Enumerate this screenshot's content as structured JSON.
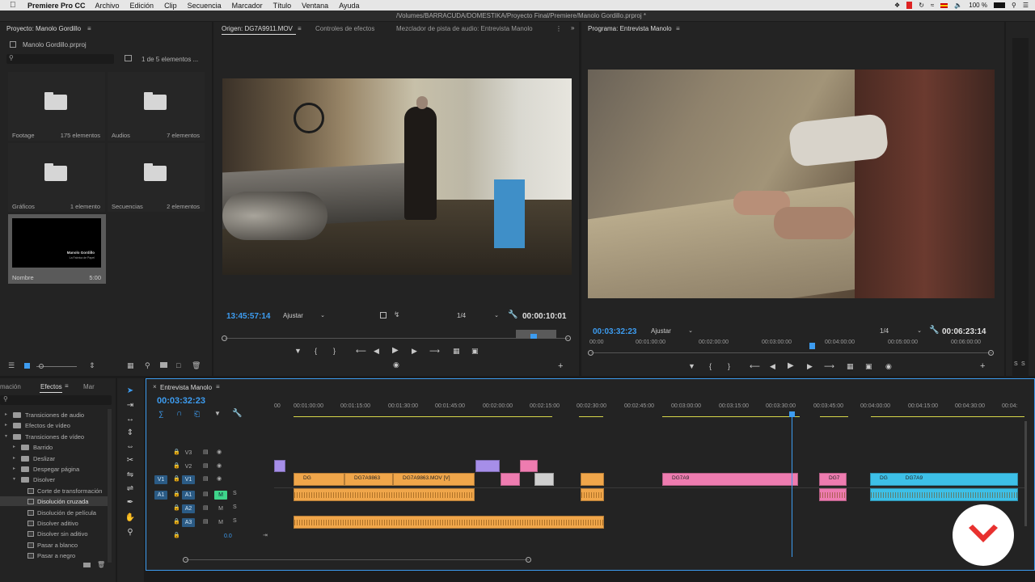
{
  "menubar": {
    "app_name": "Premiere Pro CC",
    "items": [
      "Archivo",
      "Edición",
      "Clip",
      "Secuencia",
      "Marcador",
      "Título",
      "Ventana",
      "Ayuda"
    ],
    "battery": "100 %",
    "battery_icon": "battery-icon",
    "wifi_icon": "wifi-icon"
  },
  "titlebar": {
    "path": "/Volumes/BARRACUDA/DOMESTIKA/Proyecto Final/Premiere/Manolo Gordillo.prproj *"
  },
  "project": {
    "tab": "Proyecto: Manolo Gordillo",
    "file": "Manolo Gordillo.prproj",
    "count": "1 de 5 elementos ...",
    "bins": [
      {
        "name": "Footage",
        "count": "175 elementos"
      },
      {
        "name": "Audios",
        "count": "7 elementos"
      },
      {
        "name": "Gráficos",
        "count": "1 elemento"
      },
      {
        "name": "Secuencias",
        "count": "2 elementos"
      }
    ],
    "thumb": {
      "name": "Nombre",
      "duration": "5:00",
      "title_line1": "Manolo Gordillo",
      "title_line2": "La Fabrica de Papel"
    }
  },
  "source": {
    "tabs": [
      "Origen: DG7A9911.MOV",
      "Controles de efectos",
      "Mezclador de pista de audio: Entrevista Manolo"
    ],
    "timecode": "13:45:57:14",
    "fit": "Ajustar",
    "res": "1/4",
    "duration": "00:00:10:01"
  },
  "program": {
    "tab": "Programa: Entrevista Manolo",
    "timecode": "00:03:32:23",
    "fit": "Ajustar",
    "res": "1/4",
    "duration": "00:06:23:14",
    "ruler": [
      "00:00",
      "00:01:00:00",
      "00:02:00:00",
      "00:03:00:00",
      "00:04:00:00",
      "00:05:00:00",
      "00:06:00:00"
    ]
  },
  "effects": {
    "tabs": [
      "mación",
      "Efectos",
      "Mar"
    ],
    "tree": [
      {
        "label": "Transiciones de audio",
        "level": 0,
        "kind": "folder"
      },
      {
        "label": "Efectos de vídeo",
        "level": 0,
        "kind": "folder"
      },
      {
        "label": "Transiciones de vídeo",
        "level": 0,
        "kind": "folder",
        "open": true
      },
      {
        "label": "Barrido",
        "level": 1,
        "kind": "folder"
      },
      {
        "label": "Deslizar",
        "level": 1,
        "kind": "folder"
      },
      {
        "label": "Despegar página",
        "level": 1,
        "kind": "folder"
      },
      {
        "label": "Disolver",
        "level": 1,
        "kind": "folder",
        "open": true
      },
      {
        "label": "Corte de transformación",
        "level": 2,
        "kind": "fx"
      },
      {
        "label": "Disolución cruzada",
        "level": 2,
        "kind": "fx",
        "selected": true
      },
      {
        "label": "Disolución de película",
        "level": 2,
        "kind": "fx"
      },
      {
        "label": "Disolver aditivo",
        "level": 2,
        "kind": "fx"
      },
      {
        "label": "Disolver sin aditivo",
        "level": 2,
        "kind": "fx"
      },
      {
        "label": "Pasar a blanco",
        "level": 2,
        "kind": "fx"
      },
      {
        "label": "Pasar a negro",
        "level": 2,
        "kind": "fx"
      }
    ]
  },
  "timeline": {
    "tab": "Entrevista Manolo",
    "timecode": "00:03:32:23",
    "ruler": [
      "00",
      "00:01:00:00",
      "00:01:15:00",
      "00:01:30:00",
      "00:01:45:00",
      "00:02:00:00",
      "00:02:15:00",
      "00:02:30:00",
      "00:02:45:00",
      "00:03:00:00",
      "00:03:15:00",
      "00:03:30:00",
      "00:03:45:00",
      "00:04:00:00",
      "00:04:15:00",
      "00:04:30:00",
      "00:04:"
    ],
    "tracks": {
      "v3": "V3",
      "v2": "V2",
      "v1": "V1",
      "a1": "A1",
      "a2": "A2",
      "a3": "A3",
      "src_v": "V1",
      "src_a": "A1",
      "m": "M",
      "s": "S"
    },
    "master_vol": "0.0",
    "clip_labels": [
      "DG",
      "DG7A9863",
      "DG7A9863.MOV [V]",
      "DG7A9",
      "DG7",
      "DG",
      "DG7A9"
    ]
  },
  "colors": {
    "accent_blue": "#3d9cf0",
    "clip_orange": "#f0a64a",
    "clip_pink": "#ee7cb0",
    "clip_cyan": "#3dc0e8",
    "clip_purple": "#a68ee8",
    "brand_red": "#e8312f"
  },
  "meter": {
    "s1": "S",
    "s2": "S"
  }
}
